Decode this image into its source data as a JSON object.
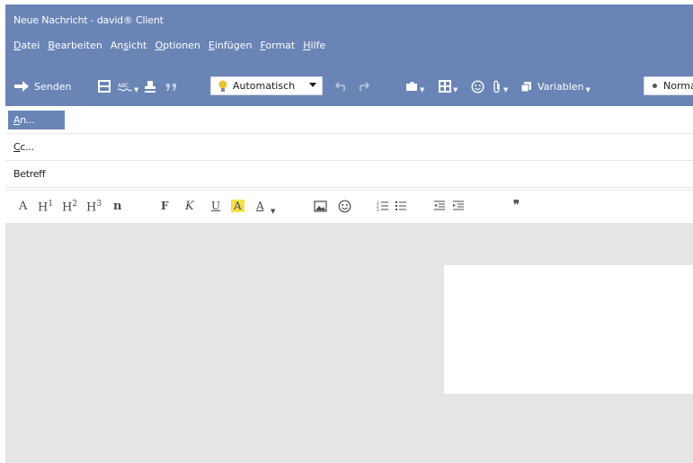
{
  "window": {
    "title": "Neue Nachricht - david® Client"
  },
  "menu": [
    {
      "pre": "",
      "u": "D",
      "post": "atei"
    },
    {
      "pre": "",
      "u": "B",
      "post": "earbeiten"
    },
    {
      "pre": "An",
      "u": "s",
      "post": "icht"
    },
    {
      "pre": "",
      "u": "O",
      "post": "ptionen"
    },
    {
      "pre": "",
      "u": "E",
      "post": "infügen"
    },
    {
      "pre": "",
      "u": "F",
      "post": "ormat"
    },
    {
      "pre": "",
      "u": "H",
      "post": "ilfe"
    }
  ],
  "toolbar": {
    "send_label": "Senden",
    "priority_value": "Automatisch",
    "variables_label": "Variablen",
    "style_value": "Norma"
  },
  "fields": {
    "to_label_u": "A",
    "to_label_rest": "n...",
    "cc_label_u": "C",
    "cc_label_rest": "c...",
    "subject_label": "Betreff"
  },
  "format": {
    "font_glyph": "A",
    "h1": "H",
    "h1_sup": "1",
    "h2": "H",
    "h2_sup": "2",
    "h3": "H",
    "h3_sup": "3",
    "normal_glyph": "n",
    "bold": "F",
    "italic": "K",
    "underline": "U",
    "highlight": "A",
    "fontcolor": "A",
    "quote": "❞"
  },
  "colors": {
    "accent": "#6a84b6",
    "body_bg": "#e5e5e5",
    "highlight": "#f5e04a"
  },
  "icons": [
    "arrow-right-icon",
    "save-icon",
    "spellcheck-icon",
    "stamp-icon",
    "quote-icon",
    "lightbulb-icon",
    "undo-icon",
    "redo-icon",
    "folder-icon",
    "table-icon",
    "smiley-icon",
    "paperclip-icon",
    "copy-icon",
    "image-icon",
    "numbered-list-icon",
    "bullet-list-icon",
    "outdent-icon",
    "indent-icon"
  ]
}
